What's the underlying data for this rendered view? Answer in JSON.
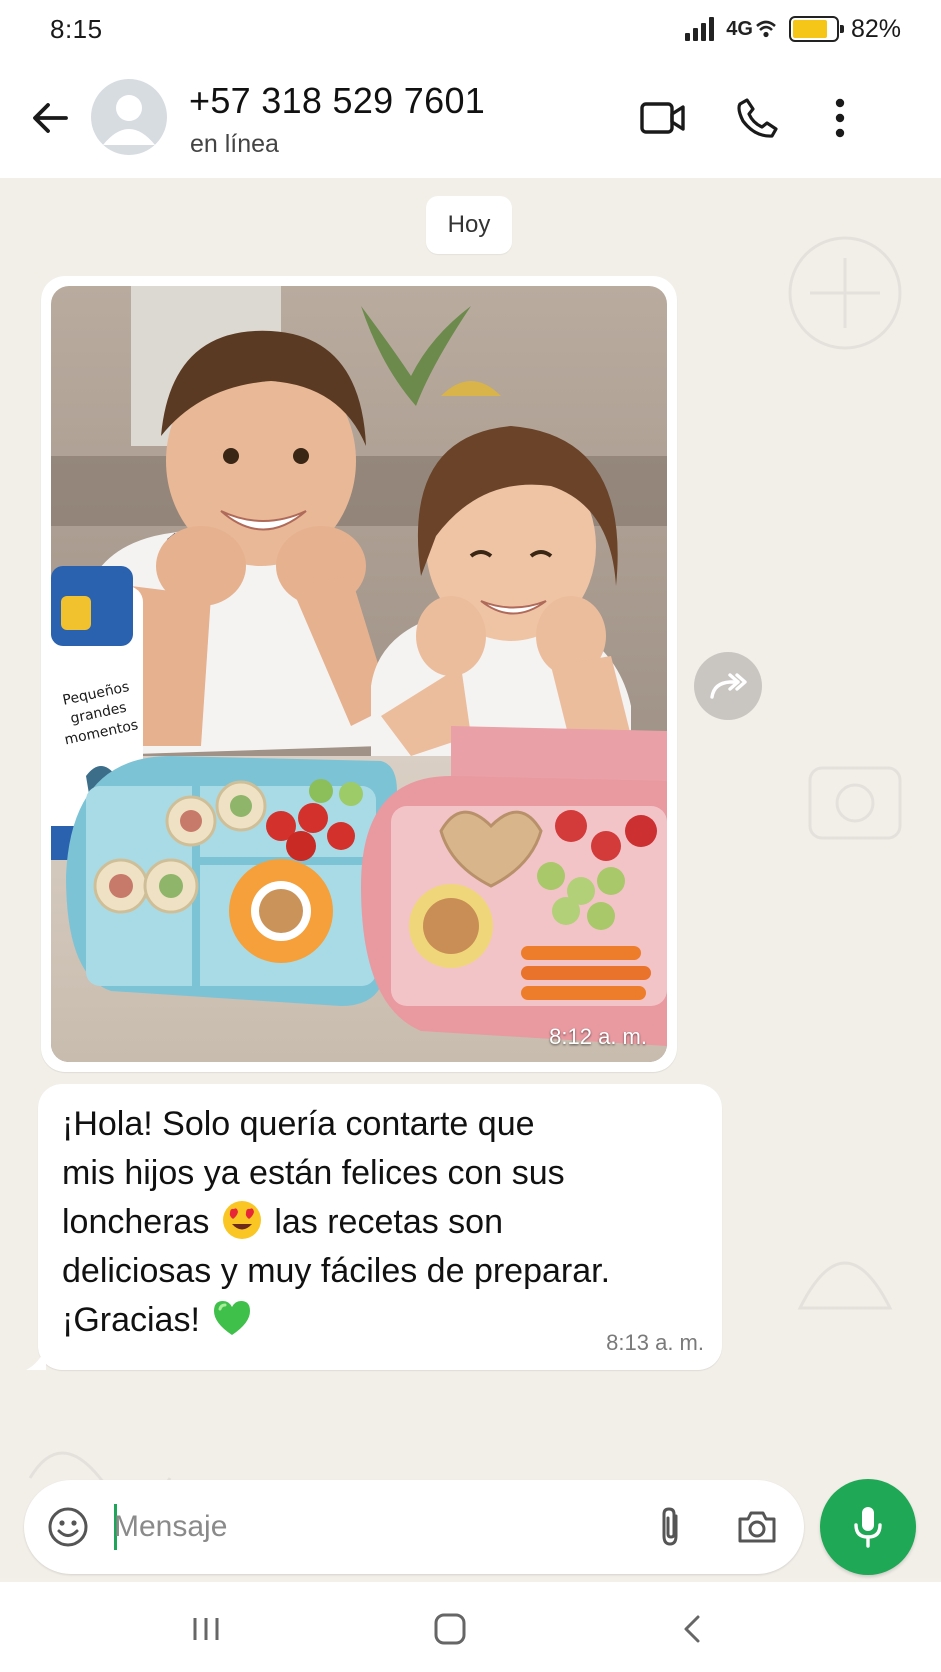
{
  "status_bar": {
    "time": "8:15",
    "network": "4G",
    "battery_percent": "82%",
    "battery_level": 0.82,
    "icons": [
      "signal-icon",
      "wifi-icon",
      "battery-icon"
    ]
  },
  "header": {
    "contact_name": "+57 318 529 7601",
    "contact_status": "en línea",
    "icons": [
      "back-arrow-icon",
      "avatar-placeholder-icon",
      "video-call-icon",
      "phone-icon",
      "more-vert-icon"
    ]
  },
  "chat": {
    "date_chip": "Hoy",
    "image_message": {
      "time": "8:12 a. m.",
      "bottle_text": [
        "Pequeños",
        "grandes",
        "momentos"
      ]
    },
    "text_message": {
      "line1": "¡Hola! Solo quería contarte que",
      "line2": "mis hijos ya están felices con sus",
      "line3a": "loncheras",
      "line3b": "las recetas son",
      "line4": "deliciosas y muy fáciles de preparar.",
      "line5": "¡Gracias!",
      "emojis": [
        "heart-eyes-emoji",
        "green-heart-emoji"
      ],
      "time": "8:13 a. m."
    },
    "forward_icon": "forward-icon"
  },
  "input_bar": {
    "placeholder": "Mensaje",
    "value": "",
    "icons": [
      "emoji-icon",
      "attach-icon",
      "camera-icon",
      "mic-icon"
    ]
  },
  "nav_bar": {
    "icons": [
      "recents-icon",
      "home-icon",
      "back-icon"
    ]
  },
  "colors": {
    "accent_green": "#1fa855",
    "chat_background": "#f2eee8",
    "battery_yellow": "#f5c518"
  }
}
